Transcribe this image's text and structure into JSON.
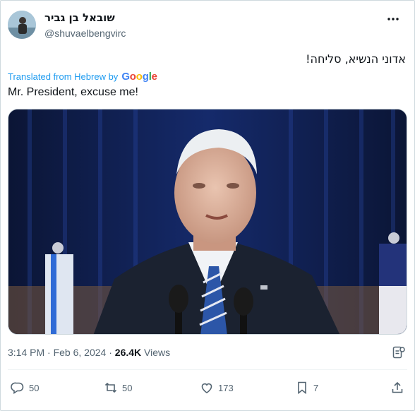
{
  "author": {
    "display_name": "שובאל בן גביר",
    "handle": "@shuvaelbengvirc"
  },
  "tweet": {
    "original_text": "אדוני הנשיא, סליחה!",
    "translated_label": "Translated from Hebrew by",
    "translator_brand": "Google",
    "translated_text": "Mr. President, excuse me!"
  },
  "meta": {
    "time": "3:14 PM",
    "separator1": "·",
    "date": "Feb 6, 2024",
    "separator2": "·",
    "views_count": "26.4K",
    "views_label": "Views"
  },
  "actions": {
    "replies": "50",
    "reposts": "50",
    "likes": "173",
    "bookmarks": "7"
  },
  "icons": {
    "more": "more-icon",
    "reply": "reply-icon",
    "repost": "repost-icon",
    "like": "heart-icon",
    "bookmark": "bookmark-icon",
    "share": "share-icon",
    "analytics": "grok-icon"
  },
  "colors": {
    "link_blue": "#1d9bf0",
    "muted_gray": "#536471",
    "text_dark": "#0f1419"
  }
}
